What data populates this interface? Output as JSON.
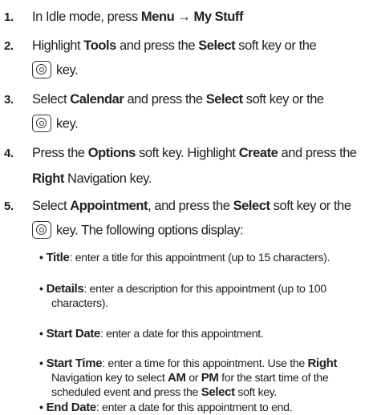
{
  "steps": [
    {
      "number": "1.",
      "lines": [
        [
          {
            "t": "In Idle mode, press "
          },
          {
            "t": "Menu",
            "b": true
          },
          {
            "t": " → ",
            "b": true
          },
          {
            "t": "My Stuff",
            "b": true
          }
        ]
      ]
    },
    {
      "number": "2.",
      "lines": [
        [
          {
            "t": "Highlight "
          },
          {
            "t": "Tools",
            "b": true
          },
          {
            "t": " and press the "
          },
          {
            "t": "Select",
            "b": true
          },
          {
            "t": " soft key or the"
          }
        ],
        [
          {
            "icon": "select-key-icon"
          },
          {
            "t": "key."
          }
        ]
      ]
    },
    {
      "number": "3.",
      "lines": [
        [
          {
            "t": "Select "
          },
          {
            "t": "Calendar",
            "b": true
          },
          {
            "t": " and press the "
          },
          {
            "t": "Select",
            "b": true
          },
          {
            "t": " soft key or the"
          }
        ],
        [
          {
            "icon": "select-key-icon"
          },
          {
            "t": "key."
          }
        ]
      ]
    },
    {
      "number": "4.",
      "lines": [
        [
          {
            "t": "Press the "
          },
          {
            "t": "Options",
            "b": true
          },
          {
            "t": " soft key. Highlight "
          },
          {
            "t": "Create",
            "b": true
          },
          {
            "t": " and press the"
          }
        ],
        [
          {
            "t": "Right",
            "b": true
          },
          {
            "t": " Navigation key."
          }
        ]
      ]
    },
    {
      "number": "5.",
      "lines": [
        [
          {
            "t": "Select "
          },
          {
            "t": "Appointment",
            "b": true
          },
          {
            "t": ", and press the "
          },
          {
            "t": "Select",
            "b": true
          },
          {
            "t": " soft key or the"
          }
        ],
        [
          {
            "icon": "select-key-icon"
          },
          {
            "t": "key. The following options display:"
          }
        ]
      ]
    }
  ],
  "options": [
    {
      "lines": [
        [
          {
            "t": "Title",
            "b": true
          },
          {
            "t": ": enter a title for this appointment (up to 15 characters)."
          }
        ]
      ]
    },
    {
      "lines": [
        [
          {
            "t": "Details",
            "b": true
          },
          {
            "t": ": enter a description for this appointment (up to 100"
          }
        ],
        [
          {
            "t": "characters)."
          }
        ]
      ]
    },
    {
      "lines": [
        [
          {
            "t": "Start Date",
            "b": true
          },
          {
            "t": ": enter a date for this appointment."
          }
        ]
      ]
    },
    {
      "lines": [
        [
          {
            "t": "Start Time",
            "b": true
          },
          {
            "t": ": enter a time for this appointment. Use the "
          },
          {
            "t": "Right",
            "b": true
          }
        ],
        [
          {
            "t": "Navigation key to select "
          },
          {
            "t": "AM",
            "b": true
          },
          {
            "t": " or "
          },
          {
            "t": "PM",
            "b": true
          },
          {
            "t": " for the start time of the"
          }
        ],
        [
          {
            "t": "scheduled event and press the "
          },
          {
            "t": "Select",
            "b": true
          },
          {
            "t": " soft key."
          }
        ]
      ]
    },
    {
      "lines": [
        [
          {
            "t": "End Date",
            "b": true
          },
          {
            "t": ": enter a date for this appointment to end."
          }
        ]
      ]
    }
  ],
  "bullet_char": "•"
}
